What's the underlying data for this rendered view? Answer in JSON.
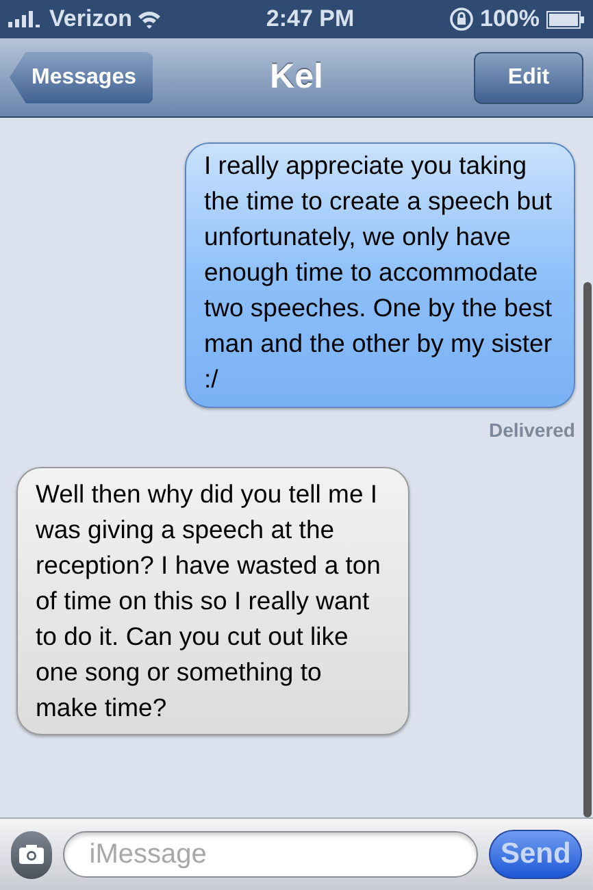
{
  "status_bar": {
    "carrier": "Verizon",
    "time": "2:47 PM",
    "battery": "100%"
  },
  "nav": {
    "back": "Messages",
    "title": "Kel",
    "action": "Edit"
  },
  "messages": [
    {
      "kind": "sent",
      "text": "I really appreciate you taking the time to create a speech but unfortunately, we only have enough time to accommodate two speeches. One by the best man and the other by my sister :/",
      "status": "Delivered"
    },
    {
      "kind": "received",
      "text": "Well then why did you tell me I was giving a speech at the reception? I have wasted a ton of time on this so I really want to do it. Can you cut out like one song or something to make time?"
    }
  ],
  "composer": {
    "placeholder": "iMessage",
    "send": "Send"
  }
}
